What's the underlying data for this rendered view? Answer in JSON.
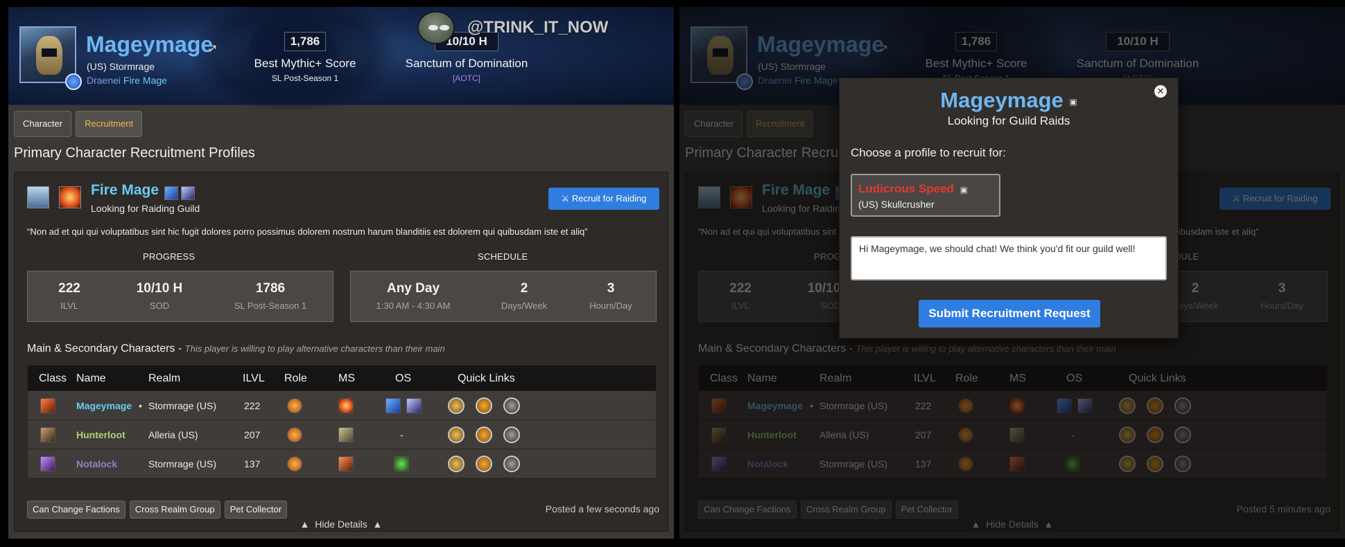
{
  "header": {
    "character_name": "Mageymage",
    "realm": "(US) Stormrage",
    "race": "Draenei",
    "class": "Fire Mage",
    "mythic_score": "1,786",
    "mythic_label": "Best Mythic+ Score",
    "mythic_season": "SL Post-Season 1",
    "raid_progress": "10/10 H",
    "raid_name": "Sanctum of Domination",
    "raid_note": "[AOTC]"
  },
  "watermark": "@TRINK_IT_NOW",
  "tabs": [
    "Character",
    "Recruitment"
  ],
  "page_title": "Primary Character Recruitment Profiles",
  "profile": {
    "title": "Fire Mage",
    "subtitle": "Looking for Raiding Guild",
    "recruit_button": "Recruit for Raiding",
    "quote": "“Non ad et qui qui voluptatibus sint hic fugit dolores porro possimus dolorem nostrum harum blanditiis est dolorem qui quibusdam iste et aliq”",
    "progress_label": "PROGRESS",
    "schedule_label": "SCHEDULE",
    "progress": [
      {
        "value": "222",
        "label": "ILVL"
      },
      {
        "value": "10/10 H",
        "label": "SOD"
      },
      {
        "value": "1786",
        "label": "SL Post-Season 1"
      }
    ],
    "schedule": [
      {
        "value": "Any Day",
        "label": "1:30 AM - 4:30 AM"
      },
      {
        "value": "2",
        "label": "Days/Week"
      },
      {
        "value": "3",
        "label": "Hours/Day"
      }
    ]
  },
  "alts": {
    "title": "Main & Secondary Characters",
    "note": "This player is willing to play alternative characters than their main",
    "columns": [
      "Class",
      "Name",
      "Realm",
      "ILVL",
      "Role",
      "MS",
      "OS",
      "Quick Links"
    ],
    "rows": [
      {
        "name": "Mageymage",
        "marker": "•",
        "realm": "Stormrage (US)",
        "ilvl": "222",
        "os": "",
        "name_color": "#69ccf0"
      },
      {
        "name": "Hunterloot",
        "marker": "",
        "realm": "Alleria (US)",
        "ilvl": "207",
        "os": "-",
        "name_color": "#abd473"
      },
      {
        "name": "Notalock",
        "marker": "",
        "realm": "Stormrage (US)",
        "ilvl": "137",
        "os": "",
        "name_color": "#9482c9"
      }
    ]
  },
  "tags": [
    "Can Change Factions",
    "Cross Realm Group",
    "Pet Collector"
  ],
  "posted_left": "Posted a few seconds ago",
  "posted_right": "Posted 5 minutes ago",
  "hide_details": "Hide Details",
  "modal": {
    "name": "Mageymage",
    "subtitle": "Looking for Guild Raids",
    "choose_label": "Choose a profile to recruit for:",
    "guild_name": "Ludicrous Speed",
    "guild_realm": "(US) Skullcrusher",
    "message": "Hi Mageymage, we should chat! We think you'd fit our guild well!",
    "submit": "Submit Recruitment Request"
  },
  "colors": {
    "accent": "#2f7de0",
    "mage": "#69ccf0",
    "hunter": "#abd473",
    "warlock": "#9482c9",
    "tab_active": "#e8b84a",
    "guild_name": "#e23a32"
  }
}
